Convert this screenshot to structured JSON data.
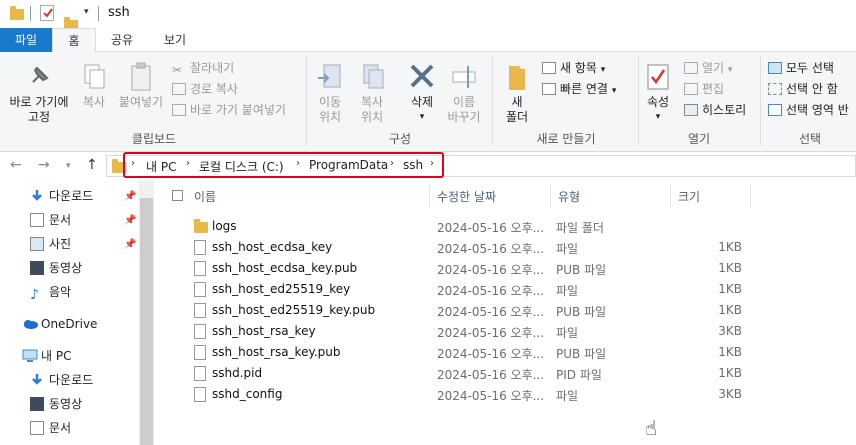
{
  "window": {
    "title": "ssh"
  },
  "ribbon_tabs": [
    "파일",
    "홈",
    "공유",
    "보기"
  ],
  "clipboard": {
    "pin_label_1": "바로 가기에",
    "pin_label_2": "고정",
    "copy": "복사",
    "paste": "붙여넣기",
    "cut": "잘라내기",
    "copy_path": "경로 복사",
    "paste_shortcut": "바로 가기 붙여넣기",
    "group": "클립보드"
  },
  "organize": {
    "move_1": "이동",
    "move_2": "위치",
    "copy_1": "복사",
    "copy_2": "위치",
    "delete": "삭제",
    "rename_1": "이름",
    "rename_2": "바꾸기",
    "group": "구성"
  },
  "new": {
    "new_folder_1": "새",
    "new_folder_2": "폴더",
    "new_item": "새 항목",
    "easy_access": "빠른 연결",
    "group": "새로 만들기"
  },
  "open": {
    "properties": "속성",
    "open": "열기",
    "edit": "편집",
    "history": "히스토리",
    "group": "열기"
  },
  "select": {
    "select_all": "모두 선택",
    "select_none": "선택 안 함",
    "invert": "선택 영역 반",
    "group": "선택"
  },
  "breadcrumb": [
    "내 PC",
    "로컬 디스크 (C:)",
    "ProgramData",
    "ssh"
  ],
  "sidebar": [
    {
      "label": "다운로드",
      "icon": "download-icon",
      "pinned": true
    },
    {
      "label": "문서",
      "icon": "document-icon",
      "pinned": true
    },
    {
      "label": "사진",
      "icon": "picture-icon",
      "pinned": true
    },
    {
      "label": "동영상",
      "icon": "video-icon",
      "pinned": false
    },
    {
      "label": "음악",
      "icon": "music-icon",
      "pinned": false
    },
    {
      "label": "OneDrive",
      "icon": "cloud-icon",
      "pinned": false
    },
    {
      "label": "내 PC",
      "icon": "computer-icon",
      "pinned": false
    },
    {
      "label": "다운로드",
      "icon": "download-icon",
      "pinned": false
    },
    {
      "label": "동영상",
      "icon": "video-icon",
      "pinned": false
    },
    {
      "label": "문서",
      "icon": "document-icon",
      "pinned": false
    }
  ],
  "columns": {
    "name": "이름",
    "date": "수정한 날짜",
    "type": "유형",
    "size": "크기"
  },
  "files": [
    {
      "name": "logs",
      "date": "2024-05-16 오후...",
      "type": "파일 폴더",
      "size": "",
      "folder": true
    },
    {
      "name": "ssh_host_ecdsa_key",
      "date": "2024-05-16 오후...",
      "type": "파일",
      "size": "1KB",
      "folder": false
    },
    {
      "name": "ssh_host_ecdsa_key.pub",
      "date": "2024-05-16 오후...",
      "type": "PUB 파일",
      "size": "1KB",
      "folder": false
    },
    {
      "name": "ssh_host_ed25519_key",
      "date": "2024-05-16 오후...",
      "type": "파일",
      "size": "1KB",
      "folder": false
    },
    {
      "name": "ssh_host_ed25519_key.pub",
      "date": "2024-05-16 오후...",
      "type": "PUB 파일",
      "size": "1KB",
      "folder": false
    },
    {
      "name": "ssh_host_rsa_key",
      "date": "2024-05-16 오후...",
      "type": "파일",
      "size": "3KB",
      "folder": false
    },
    {
      "name": "ssh_host_rsa_key.pub",
      "date": "2024-05-16 오후...",
      "type": "PUB 파일",
      "size": "1KB",
      "folder": false
    },
    {
      "name": "sshd.pid",
      "date": "2024-05-16 오후...",
      "type": "PID 파일",
      "size": "1KB",
      "folder": false
    },
    {
      "name": "sshd_config",
      "date": "2024-05-16 오후...",
      "type": "파일",
      "size": "3KB",
      "folder": false
    }
  ],
  "colors": {
    "accent": "#1979ca",
    "highlight_box": "#e0001b",
    "folder": "#e8b94a"
  }
}
